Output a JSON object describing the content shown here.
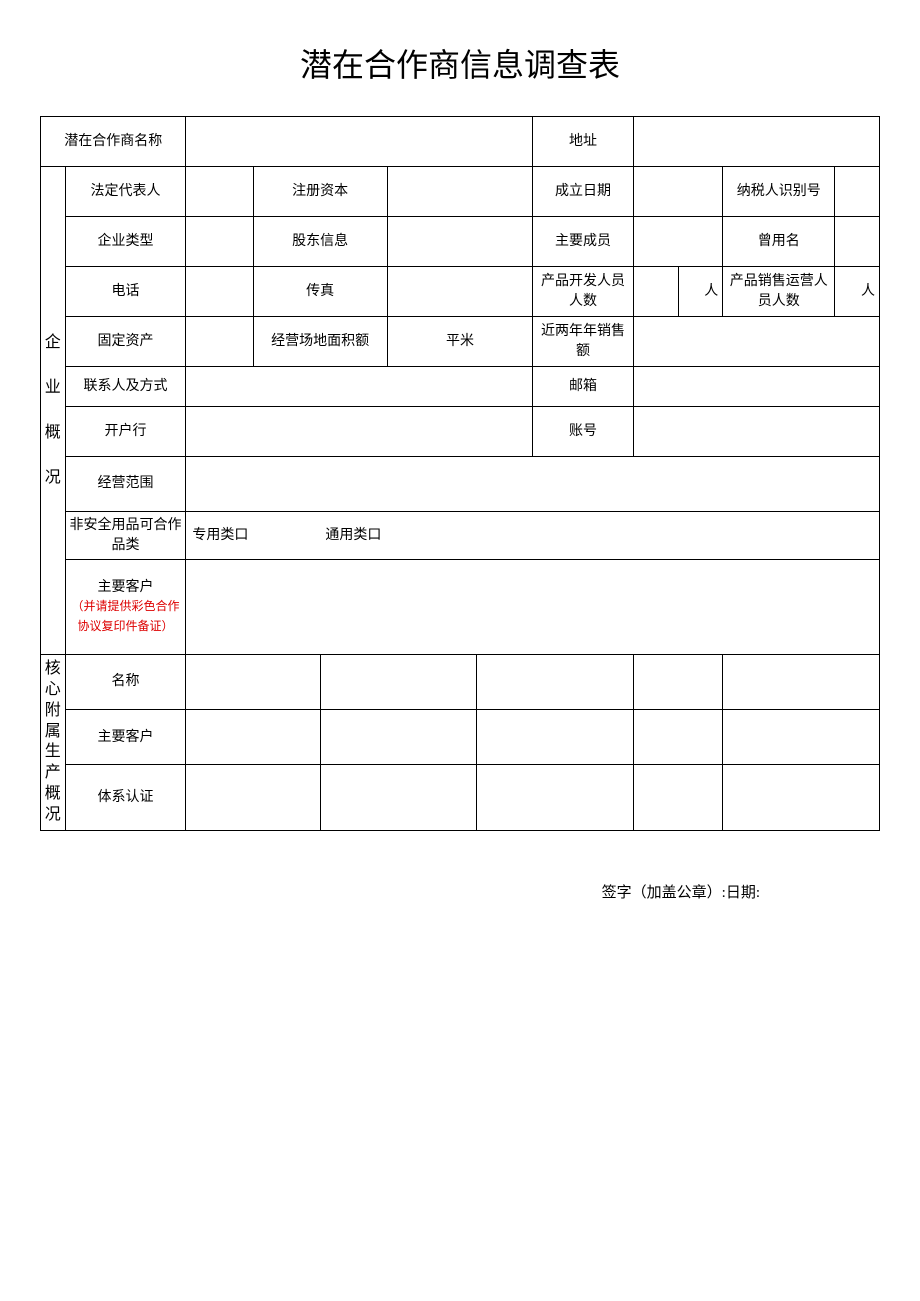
{
  "title": "潜在合作商信息调查表",
  "labels": {
    "partnerName": "潜在合作商名称",
    "address": "地址",
    "section1": "企\n\n业\n\n概\n\n况",
    "legalRep": "法定代表人",
    "regCapital": "注册资本",
    "foundDate": "成立日期",
    "taxId": "纳税人识别号",
    "enterpriseType": "企业类型",
    "shareholderInfo": "股东信息",
    "mainMembers": "主要成员",
    "formerName": "曾用名",
    "phone": "电话",
    "fax": "传真",
    "devStaff": "产品开发人员人数",
    "salesStaff": "产品销售运营人员人数",
    "people": "人",
    "fixedAssets": "固定资产",
    "siteArea": "经营场地面积额",
    "sqm": "平米",
    "recentSales": "近两年年销售额",
    "contact": "联系人及方式",
    "email": "邮箱",
    "bank": "开户行",
    "account": "账号",
    "bizScope": "经营范围",
    "categories": "非安全用品可合作品类",
    "catSpecial": "专用类口",
    "catGeneral": "通用类口",
    "mainCustomers": "主要客户",
    "customerNote": "（并请提供彩色合作协议复印件备证）",
    "section2": "核心附属生产概况",
    "prodName": "名称",
    "prodCustomers": "主要客户",
    "prodCert": "体系认证"
  },
  "signature": {
    "sign": "签字（加盖公章）:",
    "date": "日期:"
  }
}
